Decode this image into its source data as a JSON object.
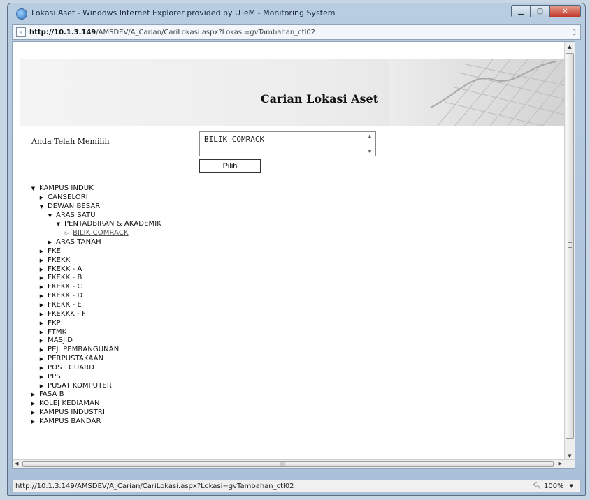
{
  "window": {
    "title": "Lokasi Aset - Windows Internet Explorer provided by UTeM - Monitoring System",
    "icon": "ie-icon",
    "controls": [
      "minimize",
      "maximize",
      "close"
    ]
  },
  "address_bar": {
    "host": "http://10.1.3.149",
    "path": "/AMSDEV/A_Carian/CariLokasi.aspx?Lokasi=gvTambahan_ctl02"
  },
  "page": {
    "title": "Carian Lokasi Aset",
    "selected_label": "Anda Telah Memilih",
    "selected_value": "BILIK COMRACK",
    "pick_button": "Pilih"
  },
  "tree": [
    {
      "label": "KAMPUS INDUK",
      "level": 0,
      "state": "expanded"
    },
    {
      "label": "CANSELORI",
      "level": 1,
      "state": "collapsed"
    },
    {
      "label": "DEWAN BESAR",
      "level": 1,
      "state": "expanded"
    },
    {
      "label": "ARAS SATU",
      "level": 2,
      "state": "expanded"
    },
    {
      "label": "PENTADBIRAN & AKADEMIK",
      "level": 3,
      "state": "expanded"
    },
    {
      "label": "BILIK COMRACK",
      "level": 4,
      "state": "leaf",
      "selected": true
    },
    {
      "label": "ARAS TANAH",
      "level": 2,
      "state": "collapsed"
    },
    {
      "label": "FKE",
      "level": 1,
      "state": "collapsed"
    },
    {
      "label": "FKEKK",
      "level": 1,
      "state": "collapsed"
    },
    {
      "label": "FKEKK - A",
      "level": 1,
      "state": "collapsed"
    },
    {
      "label": "FKEKK - B",
      "level": 1,
      "state": "collapsed"
    },
    {
      "label": "FKEKK - C",
      "level": 1,
      "state": "collapsed"
    },
    {
      "label": "FKEKK - D",
      "level": 1,
      "state": "collapsed"
    },
    {
      "label": "FKEKK - E",
      "level": 1,
      "state": "collapsed"
    },
    {
      "label": "FKEKKK - F",
      "level": 1,
      "state": "collapsed"
    },
    {
      "label": "FKP",
      "level": 1,
      "state": "collapsed"
    },
    {
      "label": "FTMK",
      "level": 1,
      "state": "collapsed"
    },
    {
      "label": "MASJID",
      "level": 1,
      "state": "collapsed"
    },
    {
      "label": "PEJ. PEMBANGUNAN",
      "level": 1,
      "state": "collapsed"
    },
    {
      "label": "PERPUSTAKAAN",
      "level": 1,
      "state": "collapsed"
    },
    {
      "label": "POST GUARD",
      "level": 1,
      "state": "collapsed"
    },
    {
      "label": "PPS",
      "level": 1,
      "state": "collapsed"
    },
    {
      "label": "PUSAT KOMPUTER",
      "level": 1,
      "state": "collapsed"
    },
    {
      "label": "FASA B",
      "level": 0,
      "state": "collapsed"
    },
    {
      "label": "KOLEJ KEDIAMAN",
      "level": 0,
      "state": "collapsed"
    },
    {
      "label": "KAMPUS INDUSTRI",
      "level": 0,
      "state": "collapsed"
    },
    {
      "label": "KAMPUS BANDAR",
      "level": 0,
      "state": "collapsed"
    }
  ],
  "status_bar": {
    "url": "http://10.1.3.149/AMSDEV/A_Carian/CariLokasi.aspx?Lokasi=gvTambahan_ctl02",
    "zoom": "100%"
  }
}
